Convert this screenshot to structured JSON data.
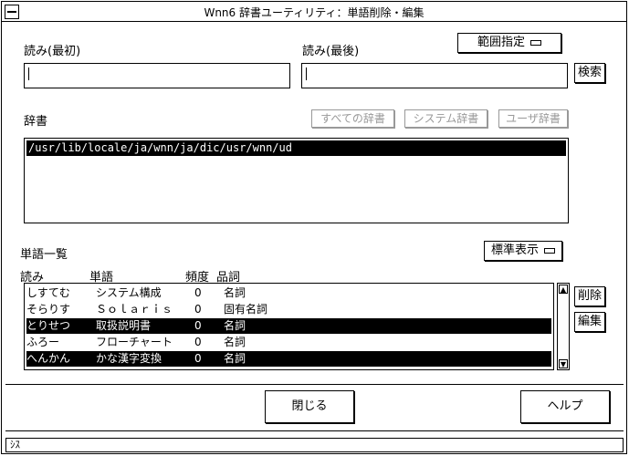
{
  "window": {
    "title": "Wnn6 辞書ユーティリティ：単語削除・編集"
  },
  "search": {
    "yomi_first_label": "読み(最初)",
    "yomi_last_label": "読み(最後)",
    "range_button": "範囲指定",
    "search_button": "検索",
    "yomi_first_value": "",
    "yomi_last_value": ""
  },
  "dictionary": {
    "label": "辞書",
    "all_button": "すべての辞書",
    "system_button": "システム辞書",
    "user_button": "ユーザ辞書",
    "items": [
      "/usr/lib/locale/ja/wnn/ja/dic/usr/wnn/ud"
    ]
  },
  "word_list": {
    "label": "単語一覧",
    "display_button": "標準表示",
    "columns": {
      "yomi": "読み",
      "word": "単語",
      "freq": "頻度",
      "pos": "品詞"
    },
    "rows": [
      {
        "yomi": "しすてむ",
        "word": "システム構成",
        "freq": "0",
        "pos": "名詞",
        "selected": false
      },
      {
        "yomi": "そらりす",
        "word": "Ｓｏｌａｒｉｓ",
        "freq": "0",
        "pos": "固有名詞",
        "selected": false
      },
      {
        "yomi": "とりせつ",
        "word": "取扱説明書",
        "freq": "0",
        "pos": "名詞",
        "selected": true
      },
      {
        "yomi": "ふろー",
        "word": "フローチャート",
        "freq": "0",
        "pos": "名詞",
        "selected": false
      },
      {
        "yomi": "へんかん",
        "word": "かな漢字変換",
        "freq": "0",
        "pos": "名詞",
        "selected": true
      }
    ],
    "delete_button": "削除",
    "edit_button": "編集"
  },
  "footer": {
    "close_button": "閉じる",
    "help_button": "ヘルプ"
  },
  "status": {
    "text": "ｼｽ"
  }
}
